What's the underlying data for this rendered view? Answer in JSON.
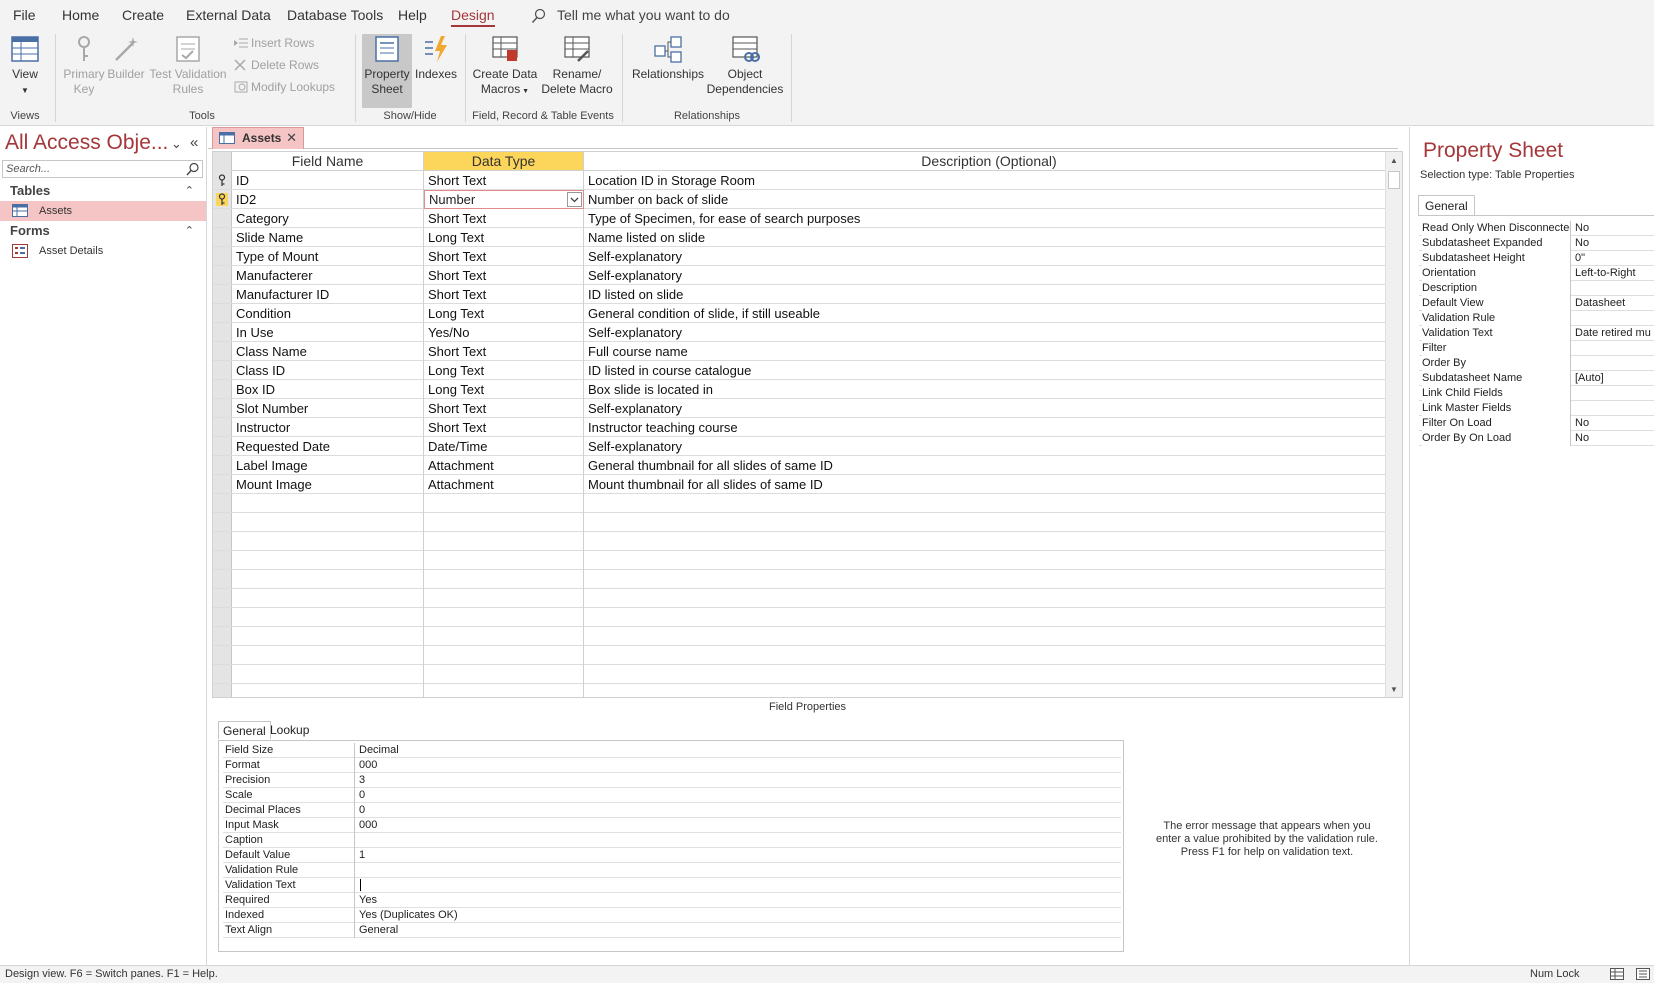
{
  "menu": {
    "file": "File",
    "home": "Home",
    "create": "Create",
    "external_data": "External Data",
    "database_tools": "Database Tools",
    "help": "Help",
    "design": "Design",
    "tell_me": "Tell me what you want to do"
  },
  "ribbon": {
    "view": "View",
    "primary_key": [
      "Primary",
      "Key"
    ],
    "builder": "Builder",
    "test_validation": [
      "Test Validation",
      "Rules"
    ],
    "insert_rows": "Insert Rows",
    "delete_rows": "Delete Rows",
    "modify_lookups": "Modify Lookups",
    "property_sheet": [
      "Property",
      "Sheet"
    ],
    "indexes": "Indexes",
    "create_data_macros": [
      "Create Data",
      "Macros"
    ],
    "rename_delete_macro": [
      "Rename/",
      "Delete Macro"
    ],
    "relationships": "Relationships",
    "object_dependencies": [
      "Object",
      "Dependencies"
    ],
    "groups": {
      "views": "Views",
      "tools": "Tools",
      "show_hide": "Show/Hide",
      "field_events": "Field, Record & Table Events",
      "relationships": "Relationships"
    }
  },
  "nav": {
    "title": "All Access Obje...",
    "search_placeholder": "Search...",
    "tables_header": "Tables",
    "tables": [
      "Assets"
    ],
    "forms_header": "Forms",
    "forms": [
      "Asset Details"
    ]
  },
  "doc_tab": {
    "label": "Assets"
  },
  "design_grid": {
    "headers": {
      "field_name": "Field Name",
      "data_type": "Data Type",
      "description": "Description (Optional)"
    },
    "rows": [
      {
        "name": "ID",
        "type": "Short Text",
        "desc": "Location ID in Storage Room"
      },
      {
        "name": "ID2",
        "type": "Number",
        "desc": "Number on back of slide"
      },
      {
        "name": "Category",
        "type": "Short Text",
        "desc": "Type of Specimen, for ease of search purposes"
      },
      {
        "name": "Slide Name",
        "type": "Long Text",
        "desc": "Name listed on slide"
      },
      {
        "name": "Type of Mount",
        "type": "Short Text",
        "desc": "Self-explanatory"
      },
      {
        "name": "Manufacterer",
        "type": "Short Text",
        "desc": "Self-explanatory"
      },
      {
        "name": "Manufacturer ID",
        "type": "Short Text",
        "desc": "ID listed on slide"
      },
      {
        "name": "Condition",
        "type": "Long Text",
        "desc": "General condition of slide, if still useable"
      },
      {
        "name": "In Use",
        "type": "Yes/No",
        "desc": "Self-explanatory"
      },
      {
        "name": "Class Name",
        "type": "Short Text",
        "desc": "Full course name"
      },
      {
        "name": "Class ID",
        "type": "Long Text",
        "desc": "ID listed in course catalogue"
      },
      {
        "name": "Box ID",
        "type": "Long Text",
        "desc": "Box slide is located in"
      },
      {
        "name": "Slot Number",
        "type": "Short Text",
        "desc": "Self-explanatory"
      },
      {
        "name": "Instructor",
        "type": "Short Text",
        "desc": "Instructor teaching course"
      },
      {
        "name": "Requested Date",
        "type": "Date/Time",
        "desc": "Self-explanatory"
      },
      {
        "name": "Label Image",
        "type": "Attachment",
        "desc": "General thumbnail for all slides of same ID"
      },
      {
        "name": "Mount Image",
        "type": "Attachment",
        "desc": "Mount thumbnail for all slides of same ID"
      }
    ]
  },
  "field_properties": {
    "title": "Field Properties",
    "tabs": [
      "General",
      "Lookup"
    ],
    "rows": [
      {
        "k": "Field Size",
        "v": "Decimal"
      },
      {
        "k": "Format",
        "v": "000"
      },
      {
        "k": "Precision",
        "v": "3"
      },
      {
        "k": "Scale",
        "v": "0"
      },
      {
        "k": "Decimal Places",
        "v": "0"
      },
      {
        "k": "Input Mask",
        "v": "000"
      },
      {
        "k": "Caption",
        "v": ""
      },
      {
        "k": "Default Value",
        "v": "1"
      },
      {
        "k": "Validation Rule",
        "v": ""
      },
      {
        "k": "Validation Text",
        "v": ""
      },
      {
        "k": "Required",
        "v": "Yes"
      },
      {
        "k": "Indexed",
        "v": "Yes (Duplicates OK)"
      },
      {
        "k": "Text Align",
        "v": "General"
      }
    ],
    "help": [
      "The error message that appears when you",
      "enter a value prohibited by the validation rule.",
      "Press F1 for help on validation text."
    ]
  },
  "property_sheet": {
    "title": "Property Sheet",
    "selection_type": "Selection type:  Table Properties",
    "tab": "General",
    "rows": [
      {
        "k": "Read Only When Disconnected",
        "v": "No"
      },
      {
        "k": "Subdatasheet Expanded",
        "v": "No"
      },
      {
        "k": "Subdatasheet Height",
        "v": "0\""
      },
      {
        "k": "Orientation",
        "v": "Left-to-Right"
      },
      {
        "k": "Description",
        "v": ""
      },
      {
        "k": "Default View",
        "v": "Datasheet"
      },
      {
        "k": "Validation Rule",
        "v": ""
      },
      {
        "k": "Validation Text",
        "v": "Date retired mu"
      },
      {
        "k": "Filter",
        "v": ""
      },
      {
        "k": "Order By",
        "v": ""
      },
      {
        "k": "Subdatasheet Name",
        "v": "[Auto]"
      },
      {
        "k": "Link Child Fields",
        "v": ""
      },
      {
        "k": "Link Master Fields",
        "v": ""
      },
      {
        "k": "Filter On Load",
        "v": "No"
      },
      {
        "k": "Order By On Load",
        "v": "No"
      }
    ]
  },
  "status": {
    "text": "Design view.  F6 = Switch panes.  F1 = Help.",
    "num_lock": "Num Lock"
  },
  "colors": {
    "accent": "#a4373a",
    "selected_nav": "#f5c4c4",
    "header_highlight": "#fcd55b"
  }
}
